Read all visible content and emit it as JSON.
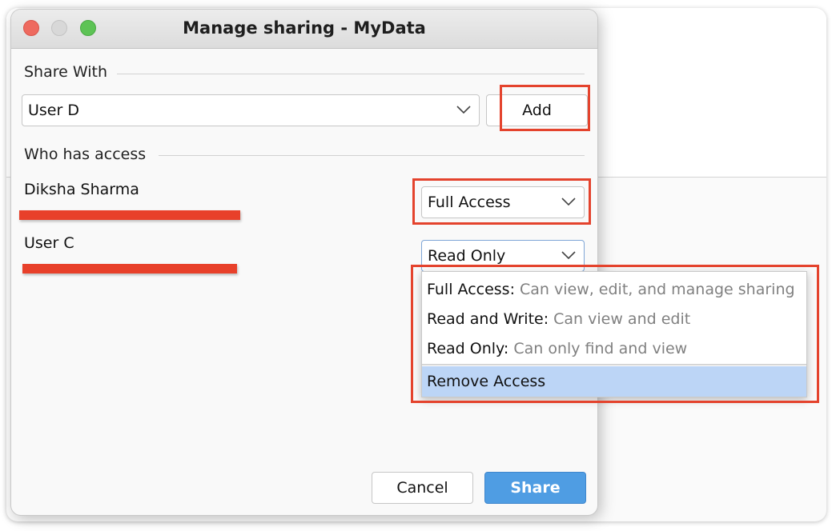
{
  "dialog": {
    "title": "Manage sharing - MyData",
    "share_with": {
      "label": "Share With",
      "selected_user": "User D",
      "add_button": "Add"
    },
    "who_has_access": {
      "label": "Who has access",
      "people": [
        {
          "name": "Diksha Sharma",
          "email_redacted": true,
          "access": "Full Access"
        },
        {
          "name": "User C",
          "email_redacted": true,
          "access": "Read Only"
        }
      ]
    },
    "access_menu": {
      "items": [
        {
          "label": "Full Access:",
          "description": "Can view, edit, and manage sharing"
        },
        {
          "label": "Read and Write:",
          "description": "Can view and edit"
        },
        {
          "label": "Read Only:",
          "description": "Can only find and view"
        }
      ],
      "remove_label": "Remove Access",
      "highlighted": "Remove Access"
    },
    "footer": {
      "cancel": "Cancel",
      "share": "Share"
    }
  },
  "colors": {
    "primary_button": "#4f9de3",
    "annotation": "#e4432d",
    "menu_highlight": "#bcd5f6"
  }
}
